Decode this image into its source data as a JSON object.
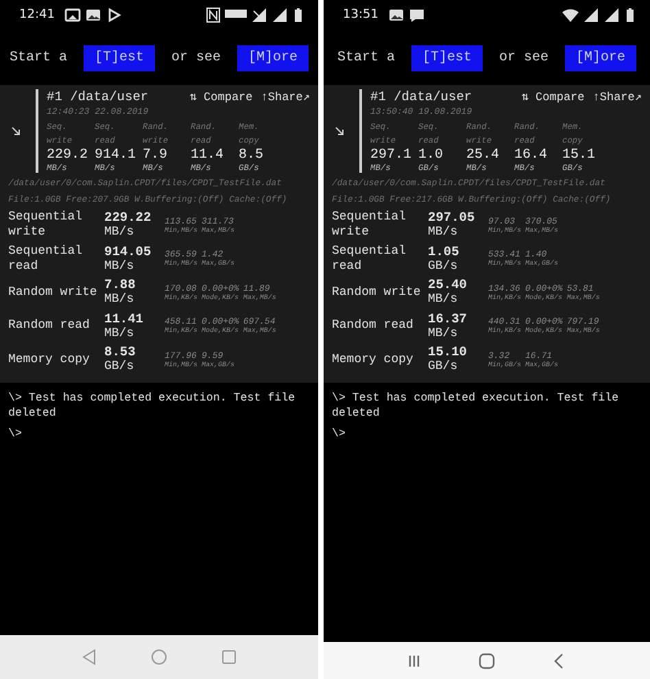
{
  "phones": [
    {
      "status_bar": {
        "time": "12:41",
        "left_icons": [
          {
            "kind": "photo"
          },
          {
            "kind": "image"
          },
          {
            "kind": "play"
          }
        ],
        "right_icons": [
          {
            "kind": "nfc"
          },
          {
            "kind": "badge"
          },
          {
            "kind": "signal-off"
          },
          {
            "kind": "signal"
          },
          {
            "kind": "battery"
          }
        ]
      },
      "actions": {
        "prefix": "Start a",
        "test_button": "[T]est",
        "middle": "or see",
        "more_button": "[M]ore"
      },
      "result": {
        "title": "#1 /data/user",
        "compare": "⇅ Compare",
        "share": "↑Share↗",
        "timestamp": "12:40:23 22.08.2019",
        "metrics": [
          {
            "label": "Seq. write",
            "value": "229.2",
            "unit": "MB/s"
          },
          {
            "label": "Seq. read",
            "value": "914.1",
            "unit": "MB/s"
          },
          {
            "label": "Rand. write",
            "value": "7.9",
            "unit": "MB/s"
          },
          {
            "label": "Rand. read",
            "value": "11.4",
            "unit": "MB/s"
          },
          {
            "label": "Mem. copy",
            "value": "8.5",
            "unit": "GB/s"
          }
        ],
        "path": "/data/user/0/com.Saplin.CPDT/files/CPDT_TestFile.dat",
        "file_info": "File:1.0GB Free:207.9GB W.Buffering:(Off) Cache:(Off)",
        "rows": [
          {
            "name": "Sequential write",
            "value": "229.22",
            "unit": "MB/s",
            "stats": [
              {
                "value": "113.65",
                "label": "Min,MB/s"
              },
              {
                "value": "311.73",
                "label": "Max,MB/s"
              }
            ]
          },
          {
            "name": "Sequential read",
            "value": "914.05",
            "unit": "MB/s",
            "stats": [
              {
                "value": "365.59",
                "label": "Min,MB/s"
              },
              {
                "value": "1.42",
                "label": "Max,GB/s"
              }
            ]
          },
          {
            "name": "Random write",
            "value": "7.88",
            "unit": "MB/s",
            "stats": [
              {
                "value": "170.08",
                "label": "Min,KB/s"
              },
              {
                "value": "0.00+0%",
                "label": "Mode,KB/s"
              },
              {
                "value": "11.89",
                "label": "Max,MB/s"
              }
            ]
          },
          {
            "name": "Random read",
            "value": "11.41",
            "unit": "MB/s",
            "stats": [
              {
                "value": "458.11",
                "label": "Min,KB/s"
              },
              {
                "value": "0.00+0%",
                "label": "Mode,KB/s"
              },
              {
                "value": "697.54",
                "label": "Max,MB/s"
              }
            ]
          },
          {
            "name": "Memory copy",
            "value": "8.53",
            "unit": "GB/s",
            "stats": [
              {
                "value": "177.96",
                "label": "Min,MB/s"
              },
              {
                "value": "9.59",
                "label": "Max,GB/s"
              }
            ]
          }
        ]
      },
      "terminal": [
        "\\> Test has completed execution. Test file deleted",
        "\\>"
      ],
      "nav_bar": [
        {
          "kind": "back-triangle"
        },
        {
          "kind": "home-circle"
        },
        {
          "kind": "recents-square"
        }
      ]
    },
    {
      "status_bar": {
        "time": "13:51",
        "left_icons": [
          {
            "kind": "image"
          },
          {
            "kind": "message"
          }
        ],
        "right_icons": [
          {
            "kind": "wifi"
          },
          {
            "kind": "signal"
          },
          {
            "kind": "signal"
          },
          {
            "kind": "battery"
          }
        ]
      },
      "actions": {
        "prefix": "Start a",
        "test_button": "[T]est",
        "middle": "or see",
        "more_button": "[M]ore"
      },
      "result": {
        "title": "#1 /data/user",
        "compare": "⇅ Compare",
        "share": "↑Share↗",
        "timestamp": "13:50:40 19.08.2019",
        "metrics": [
          {
            "label": "Seq. write",
            "value": "297.1",
            "unit": "MB/s"
          },
          {
            "label": "Seq. read",
            "value": "1.0",
            "unit": "GB/s"
          },
          {
            "label": "Rand. write",
            "value": "25.4",
            "unit": "MB/s"
          },
          {
            "label": "Rand. read",
            "value": "16.4",
            "unit": "MB/s"
          },
          {
            "label": "Mem. copy",
            "value": "15.1",
            "unit": "GB/s"
          }
        ],
        "path": "/data/user/0/com.Saplin.CPDT/files/CPDT_TestFile.dat",
        "file_info": "File:1.0GB Free:217.6GB W.Buffering:(Off) Cache:(Off)",
        "rows": [
          {
            "name": "Sequential write",
            "value": "297.05",
            "unit": "MB/s",
            "stats": [
              {
                "value": "97.03",
                "label": "Min,MB/s"
              },
              {
                "value": "370.05",
                "label": "Max,MB/s"
              }
            ]
          },
          {
            "name": "Sequential read",
            "value": "1.05",
            "unit": "GB/s",
            "stats": [
              {
                "value": "533.41",
                "label": "Min,MB/s"
              },
              {
                "value": "1.40",
                "label": "Max,GB/s"
              }
            ]
          },
          {
            "name": "Random write",
            "value": "25.40",
            "unit": "MB/s",
            "stats": [
              {
                "value": "134.36",
                "label": "Min,KB/s"
              },
              {
                "value": "0.00+0%",
                "label": "Mode,KB/s"
              },
              {
                "value": "53.81",
                "label": "Max,MB/s"
              }
            ]
          },
          {
            "name": "Random read",
            "value": "16.37",
            "unit": "MB/s",
            "stats": [
              {
                "value": "440.31",
                "label": "Min,KB/s"
              },
              {
                "value": "0.00+0%",
                "label": "Mode,KB/s"
              },
              {
                "value": "797.19",
                "label": "Max,MB/s"
              }
            ]
          },
          {
            "name": "Memory copy",
            "value": "15.10",
            "unit": "GB/s",
            "stats": [
              {
                "value": "3.32",
                "label": "Min,GB/s"
              },
              {
                "value": "16.71",
                "label": "Max,GB/s"
              }
            ]
          }
        ]
      },
      "terminal": [
        "\\> Test has completed execution. Test file deleted",
        "\\>"
      ],
      "nav_bar": [
        {
          "kind": "recents-lines"
        },
        {
          "kind": "home-rounded"
        },
        {
          "kind": "back-chevron"
        }
      ]
    }
  ]
}
